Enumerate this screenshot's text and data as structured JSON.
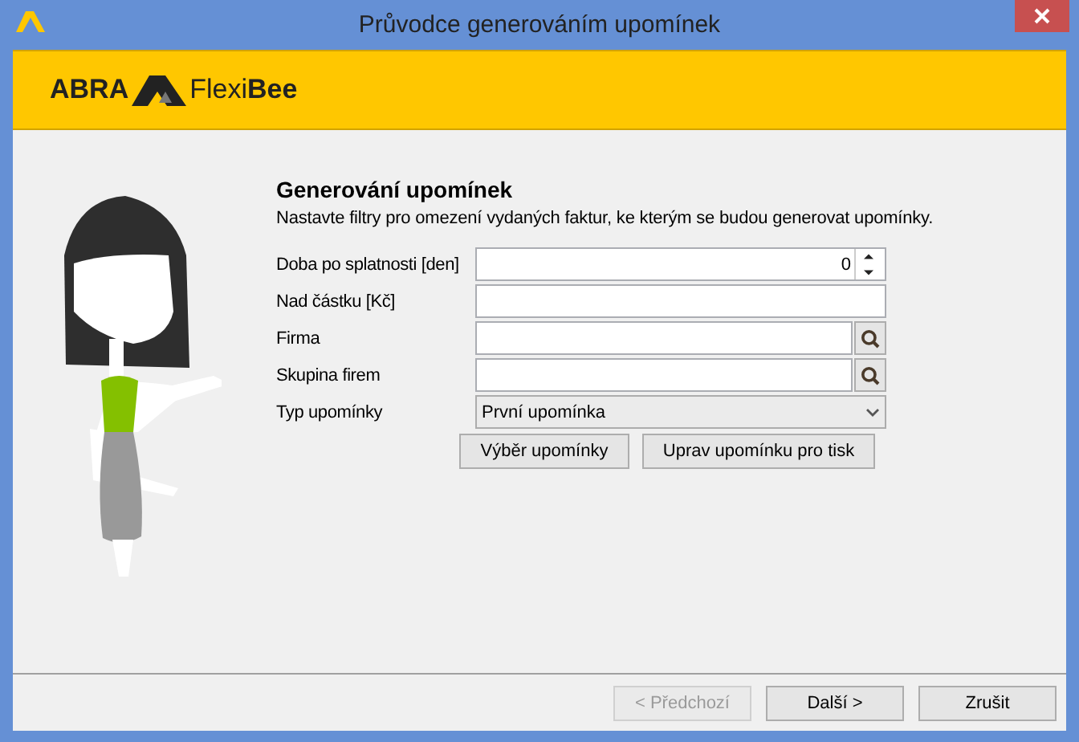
{
  "window": {
    "title": "Průvodce generováním upomínek"
  },
  "header": {
    "logo_left": "ABRA",
    "logo_right": "Flexi**Bee**"
  },
  "form": {
    "title": "Generování upomínek",
    "description": "Nastavte filtry pro omezení vydaných faktur, ke kterým se budou generovat upomínky.",
    "fields": [
      {
        "kind": "spin",
        "label": "Doba po splatnosti [den]",
        "value": "0"
      },
      {
        "kind": "text",
        "label": "Nad částku [Kč]"
      },
      {
        "kind": "lookup",
        "label": "Firma"
      },
      {
        "kind": "lookup",
        "label": "Skupina firem"
      },
      {
        "kind": "select",
        "label": "Typ upomínky",
        "value": "První upomínka"
      }
    ],
    "buttons": [
      "Výběr upomínky",
      "Uprav upomínku pro tisk"
    ]
  },
  "footer_buttons": [
    {
      "label": "< Předchozí",
      "disabled": true
    },
    {
      "label": "Další >",
      "disabled": false
    },
    {
      "label": "Zrušit",
      "disabled": false
    }
  ]
}
